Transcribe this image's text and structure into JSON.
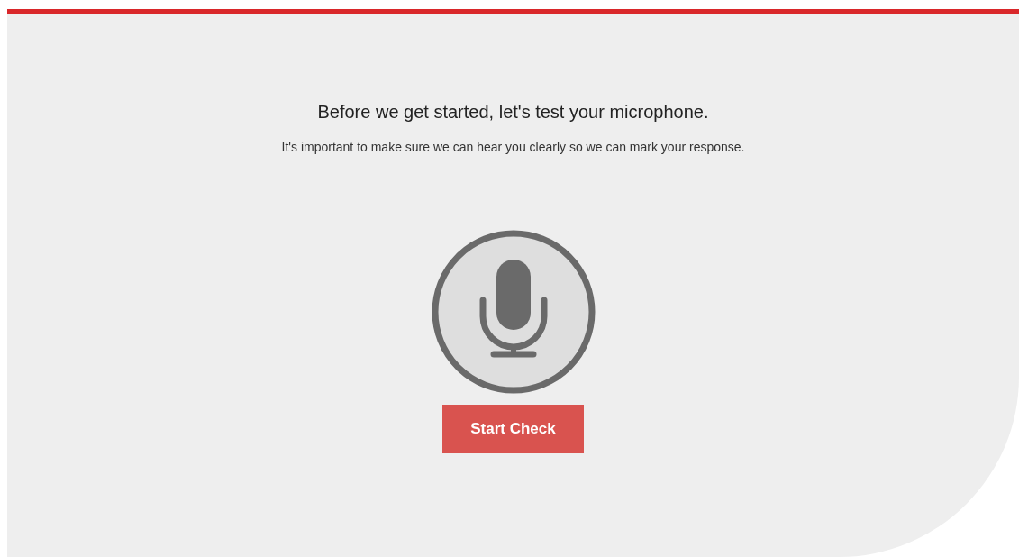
{
  "heading": "Before we get started, let's test your microphone.",
  "subtitle": "It's important to make sure we can hear you clearly so we can mark your response.",
  "button": {
    "label": "Start Check"
  }
}
